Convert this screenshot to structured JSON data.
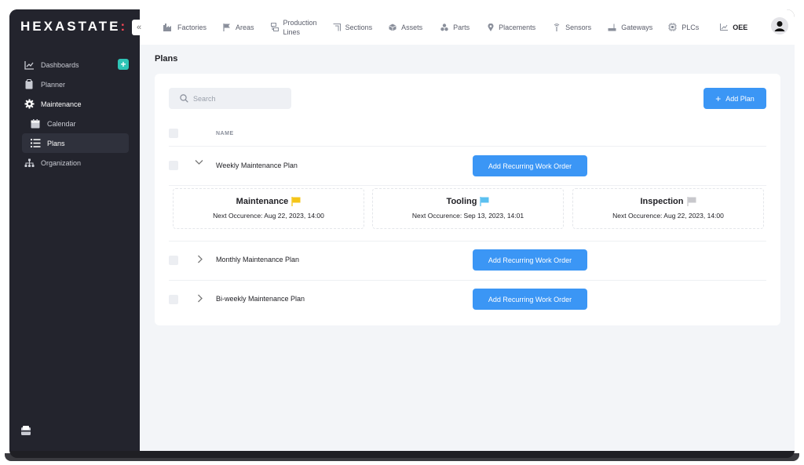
{
  "app": {
    "logo_text": "HEXASTATE",
    "logo_suffix": ":"
  },
  "sidebar": {
    "collapse_icon": "chevron-double-left-icon",
    "items": [
      {
        "label": "Dashboards",
        "icon": "chart-line-icon"
      },
      {
        "label": "Planner",
        "icon": "clipboard-icon"
      },
      {
        "label": "Maintenance",
        "icon": "gear-icon"
      },
      {
        "label": "Calendar",
        "icon": "calendar-icon"
      },
      {
        "label": "Plans",
        "icon": "list-icon"
      },
      {
        "label": "Organization",
        "icon": "org-chart-icon"
      }
    ],
    "add_label": "+"
  },
  "topbar": {
    "items": [
      {
        "label": "Factories",
        "icon": "factory-icon"
      },
      {
        "label": "Areas",
        "icon": "flag-icon"
      },
      {
        "label": "Production\nLines",
        "icon": "production-lines-icon"
      },
      {
        "label": "Sections",
        "icon": "sections-icon"
      },
      {
        "label": "Assets",
        "icon": "cube-icon"
      },
      {
        "label": "Parts",
        "icon": "parts-icon"
      },
      {
        "label": "Placements",
        "icon": "pin-icon"
      },
      {
        "label": "Sensors",
        "icon": "antenna-icon"
      },
      {
        "label": "Gateways",
        "icon": "gateway-icon"
      },
      {
        "label": "PLCs",
        "icon": "chip-icon"
      },
      {
        "label": "OEE",
        "icon": "chart-icon"
      }
    ]
  },
  "main": {
    "title": "Plans",
    "search_placeholder": "Search",
    "add_plan_label": "Add Plan",
    "column_name": "NAME",
    "rows": [
      {
        "name": "Weekly Maintenance Plan",
        "button": "Add Recurring Work Order",
        "expanded": true
      },
      {
        "name": "Monthly Maintenance Plan",
        "button": "Add Recurring Work Order",
        "expanded": false
      },
      {
        "name": "Bi-weekly Maintenance Plan",
        "button": "Add Recurring Work Order",
        "expanded": false
      }
    ],
    "orders": [
      {
        "title": "Maintenance",
        "next": "Next Occurence: Aug 22, 2023, 14:00",
        "flag_color": "#f5c518"
      },
      {
        "title": "Tooling",
        "next": "Next Occurence: Sep 13, 2023, 14:01",
        "flag_color": "#5bc0f0"
      },
      {
        "title": "Inspection",
        "next": "Next Occurence: Aug 22, 2023, 14:00",
        "flag_color": "#c8c8cc"
      }
    ]
  },
  "colors": {
    "primary": "#3b96f5",
    "sidebar": "#23242d",
    "accent": "#2ec4b6",
    "logo_dot": "#ff4757"
  }
}
